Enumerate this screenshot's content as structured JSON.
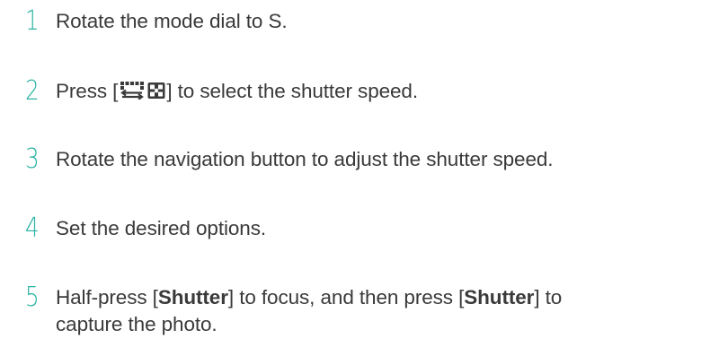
{
  "steps": [
    {
      "number": "1",
      "text": "Rotate the mode dial to S."
    },
    {
      "number": "2",
      "text_before": "Press [",
      "icon_names": [
        "swap-arrows-icon",
        "grid-button-icon"
      ],
      "text_after": "] to select the shutter speed."
    },
    {
      "number": "3",
      "text": "Rotate the navigation button to adjust the shutter speed."
    },
    {
      "number": "4",
      "text": "Set the desired options."
    },
    {
      "number": "5",
      "part1": "Half-press [",
      "bold1": "Shutter",
      "part2": "] to focus, and then press [",
      "bold2": "Shutter",
      "part3": "] to",
      "line2": "capture the photo."
    }
  ],
  "colors": {
    "step_number": "#2bb3a3",
    "body_text": "#3a3a3a"
  }
}
